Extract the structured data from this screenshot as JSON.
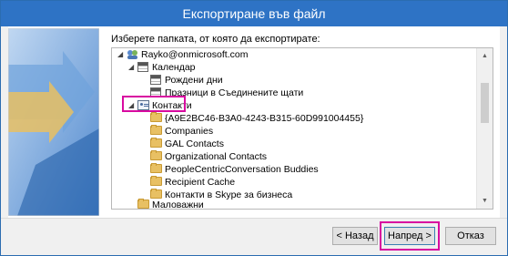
{
  "window": {
    "title": "Експортиране във файл"
  },
  "prompt": "Изберете папката, от която да експортирате:",
  "tree": {
    "items": [
      {
        "label": "Rayko@onmicrosoft.com",
        "icon": "account-icon",
        "expanded": true
      },
      {
        "label": "Календар",
        "icon": "calendar-icon",
        "expanded": true
      },
      {
        "label": "Рождени дни",
        "icon": "calendar-icon"
      },
      {
        "label": "Празници в Съединените щати",
        "icon": "calendar-icon"
      },
      {
        "label": "Контакти",
        "icon": "contact-folder-icon",
        "expanded": true
      },
      {
        "label": "{A9E2BC46-B3A0-4243-B315-60D991004455}",
        "icon": "folder-icon"
      },
      {
        "label": "Companies",
        "icon": "folder-icon"
      },
      {
        "label": "GAL Contacts",
        "icon": "folder-icon"
      },
      {
        "label": "Organizational Contacts",
        "icon": "folder-icon"
      },
      {
        "label": "PeopleCentricConversation Buddies",
        "icon": "folder-icon"
      },
      {
        "label": "Recipient Cache",
        "icon": "folder-icon"
      },
      {
        "label": "Контакти в Skype за бизнеса",
        "icon": "folder-icon"
      },
      {
        "label": "Маловажни",
        "icon": "folder-icon"
      }
    ]
  },
  "buttons": {
    "back": "< Назад",
    "next": "Напред >",
    "cancel": "Отказ"
  },
  "colors": {
    "titlebar": "#2e73c5",
    "highlight": "#d80aa0"
  }
}
